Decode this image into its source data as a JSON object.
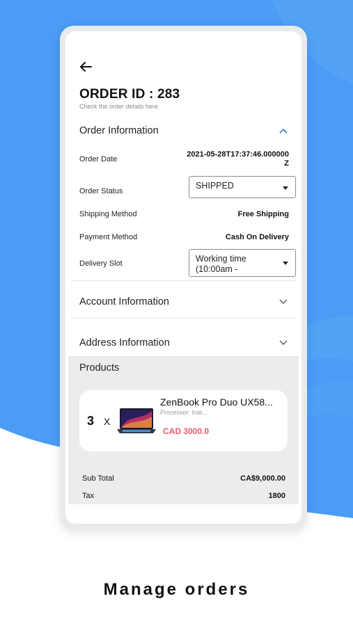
{
  "order": {
    "title": "ORDER ID : 283",
    "subtitle": "Check the order details here"
  },
  "order_information": {
    "header": "Order Information",
    "order_date_label": "Order Date",
    "order_date_value": "2021-05-28T17:37:46.000000Z",
    "order_status_label": "Order Status",
    "order_status_value": "SHIPPED",
    "shipping_method_label": "Shipping Method",
    "shipping_method_value": "Free Shipping",
    "payment_method_label": "Payment Method",
    "payment_method_value": "Cash On Delivery",
    "delivery_slot_label": "Delivery Slot",
    "delivery_slot_value": "Working time (10:00am -"
  },
  "account_information": {
    "header": "Account Information"
  },
  "address_information": {
    "header": "Address Information"
  },
  "products": {
    "header": "Products",
    "items": [
      {
        "quantity": "3",
        "multiplier": "X",
        "name": "ZenBook Pro Duo UX58...",
        "description": "Processor: Inte...",
        "price": "CAD 3000.0"
      }
    ]
  },
  "totals": {
    "sub_total_label": "Sub Total",
    "sub_total_value": "CA$9,000.00",
    "tax_label": "Tax",
    "tax_value": "1800"
  },
  "caption": "Manage orders",
  "colors": {
    "background_blue": "#4a9cf5",
    "price": "#e8596b",
    "chevron": "#2d7fd6",
    "products_bg": "#ececec"
  },
  "icons": {
    "back": "arrow-left-icon",
    "expand_open": "chevron-up-icon",
    "expand_closed": "chevron-down-icon",
    "dropdown": "caret-down-icon"
  }
}
